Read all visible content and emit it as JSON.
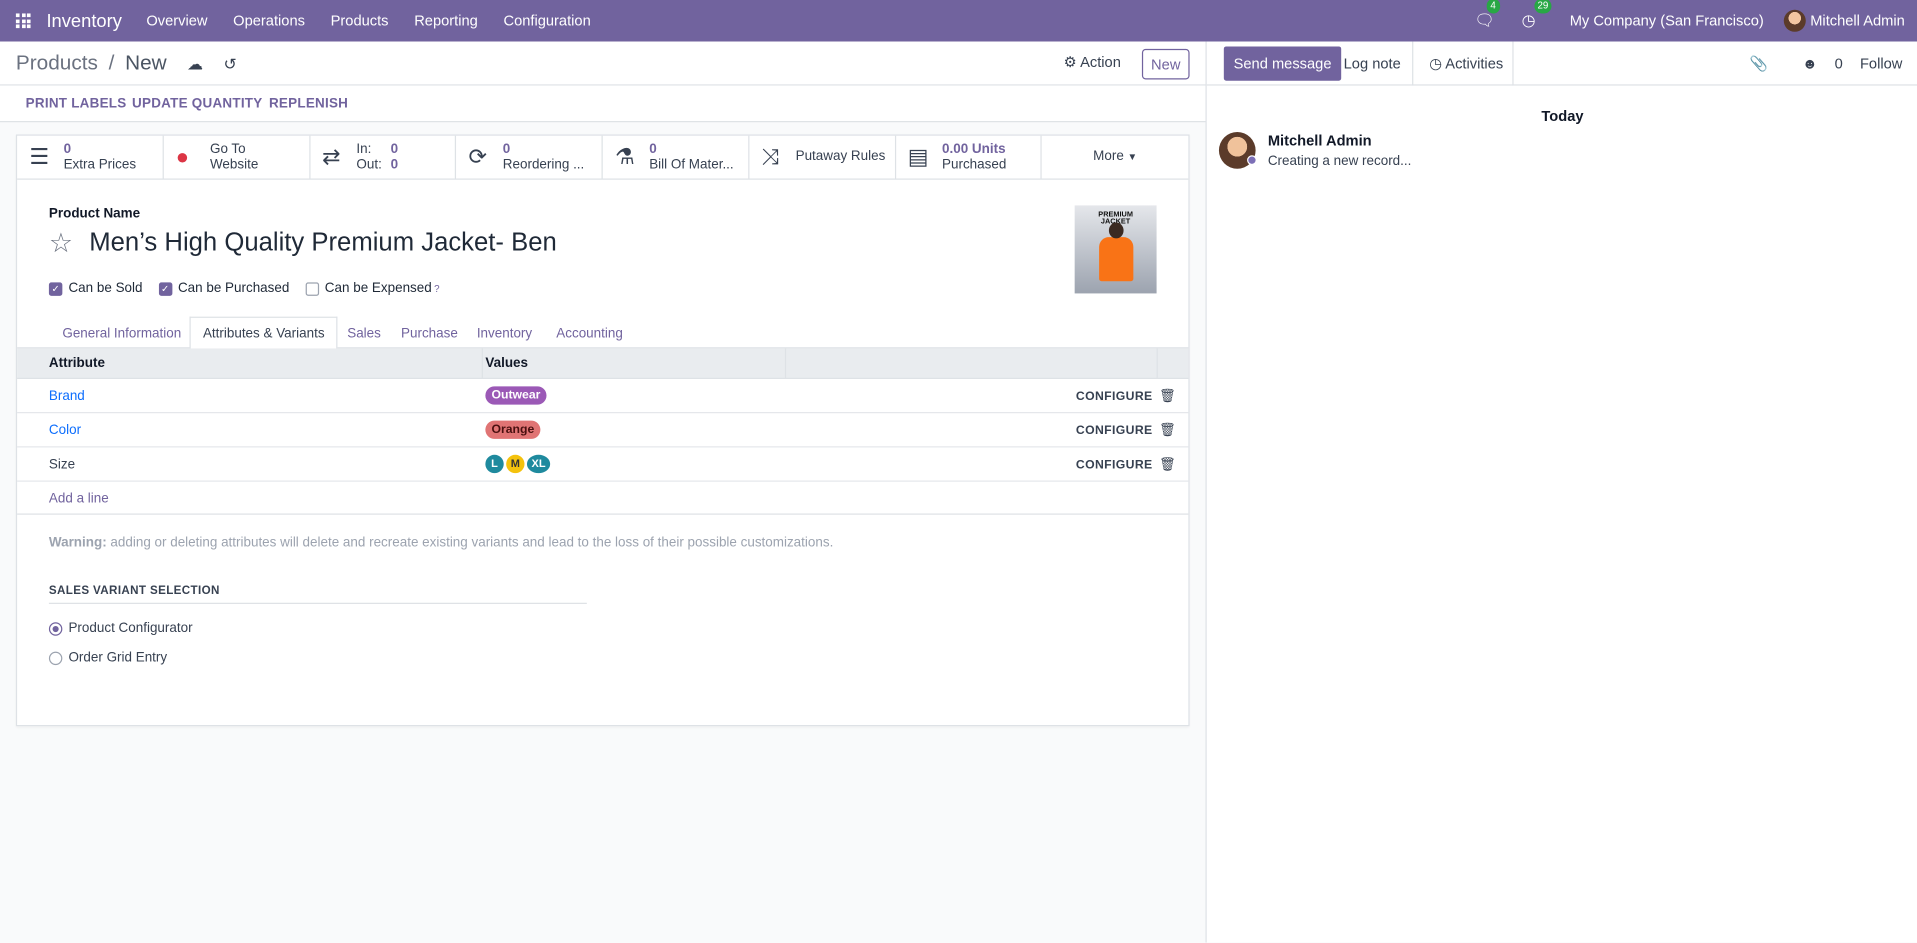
{
  "topbar": {
    "app_name": "Inventory",
    "menus": [
      "Overview",
      "Operations",
      "Products",
      "Reporting",
      "Configuration"
    ],
    "messages_count": "4",
    "activities_count": "29",
    "company": "My Company (San Francisco)",
    "user": "Mitchell Admin",
    "brand_color": "#71639e"
  },
  "control": {
    "breadcrumb_root": "Products",
    "breadcrumb_sep": "/",
    "breadcrumb_current": "New",
    "action_label": "Action",
    "new_label": "New"
  },
  "statusbar": {
    "print_labels": "PRINT LABELS",
    "update_quantity": "UPDATE QUANTITY",
    "replenish": "REPLENISH"
  },
  "smart": {
    "extra_prices_count": "0",
    "extra_prices_label": "Extra Prices",
    "website_line1": "Go To",
    "website_line2": "Website",
    "in_label": "In:",
    "in_value": "0",
    "out_label": "Out:",
    "out_value": "0",
    "reorder_count": "0",
    "reorder_label": "Reordering ...",
    "bom_count": "0",
    "bom_label": "Bill Of Mater...",
    "putaway_label": "Putaway Rules",
    "purchased_value": "0.00 Units",
    "purchased_label": "Purchased",
    "more_label": "More"
  },
  "product": {
    "name_label": "Product Name",
    "name": "Men’s High Quality Premium Jacket- Ben",
    "image_text1": "PREMIUM",
    "image_text2": "JACKET",
    "can_be_sold": "Can be Sold",
    "can_be_purchased": "Can be Purchased",
    "can_be_expensed": "Can be Expensed",
    "help_mark": "?"
  },
  "tabs": [
    "General Information",
    "Attributes & Variants",
    "Sales",
    "Purchase",
    "Inventory",
    "Accounting"
  ],
  "attributes": {
    "col_attribute": "Attribute",
    "col_values": "Values",
    "configure_label": "CONFIGURE",
    "rows": [
      {
        "name": "Brand",
        "values": [
          "Outwear"
        ]
      },
      {
        "name": "Color",
        "values": [
          "Orange"
        ]
      },
      {
        "name": "Size",
        "values": [
          "L",
          "M",
          "XL"
        ]
      }
    ],
    "add_line": "Add a line",
    "tag_colors": {
      "Outwear": "#9b59b6",
      "Orange": "#e07474",
      "L": "#1f8a9e",
      "M": "#f4c20d",
      "XL": "#1f8a9e"
    }
  },
  "warning": {
    "label": "Warning:",
    "text": " adding or deleting attributes will delete and recreate existing variants and lead to the loss of their possible customizations."
  },
  "sales_variant": {
    "title": "SALES VARIANT SELECTION",
    "option1": "Product Configurator",
    "option2": "Order Grid Entry",
    "selected": "Product Configurator"
  },
  "chatter": {
    "send_message": "Send message",
    "log_note": "Log note",
    "activities": "Activities",
    "followers_count": "0",
    "follow": "Follow",
    "date_separator": "Today",
    "message_author": "Mitchell Admin",
    "message_text": "Creating a new record..."
  }
}
